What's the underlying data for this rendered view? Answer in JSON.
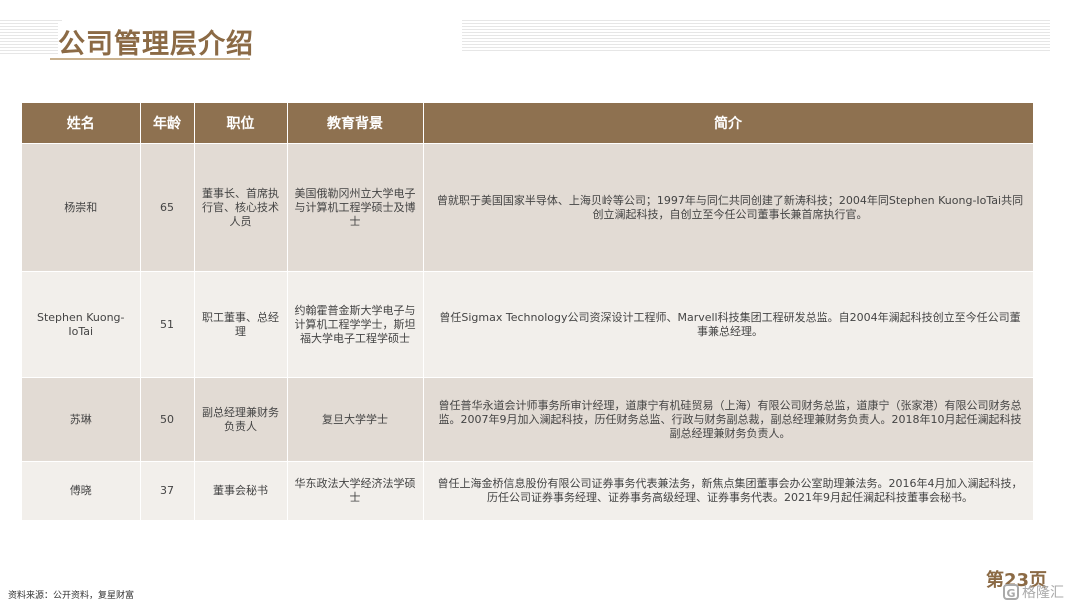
{
  "title": "公司管理层介绍",
  "table": {
    "headers": [
      "姓名",
      "年龄",
      "职位",
      "教育背景",
      "简介"
    ],
    "rows": [
      {
        "name": "杨崇和",
        "age": "65",
        "position": "董事长、首席执行官、核心技术人员",
        "education": "美国俄勒冈州立大学电子与计算机工程学硕士及博士",
        "intro": "曾就职于美国国家半导体、上海贝岭等公司；1997年与同仁共同创建了新涛科技；2004年同Stephen Kuong-IoTai共同创立澜起科技，自创立至今任公司董事长兼首席执行官。"
      },
      {
        "name": "Stephen Kuong-IoTai",
        "age": "51",
        "position": "职工董事、总经理",
        "education": "约翰霍普金斯大学电子与计算机工程学学士，斯坦福大学电子工程学硕士",
        "intro": "曾任Sigmax Technology公司资深设计工程师、Marvell科技集团工程研发总监。自2004年澜起科技创立至今任公司董事兼总经理。"
      },
      {
        "name": "苏琳",
        "age": "50",
        "position": "副总经理兼财务负责人",
        "education": "复旦大学学士",
        "intro": "曾任普华永道会计师事务所审计经理，道康宁有机硅贸易（上海）有限公司财务总监，道康宁（张家港）有限公司财务总监。2007年9月加入澜起科技，历任财务总监、行政与财务副总裁，副总经理兼财务负责人。2018年10月起任澜起科技副总经理兼财务负责人。"
      },
      {
        "name": "傅晓",
        "age": "37",
        "position": "董事会秘书",
        "education": "华东政法大学经济法学硕士",
        "intro": "曾任上海金桥信息股份有限公司证券事务代表兼法务，新焦点集团董事会办公室助理兼法务。2016年4月加入澜起科技，历任公司证券事务经理、证券事务高级经理、证券事务代表。2021年9月起任澜起科技董事会秘书。"
      }
    ]
  },
  "footer": {
    "source": "资料来源：公开资料，复星财富",
    "page": "第23页",
    "logo_text": "格隆汇",
    "logo_icon": "g-logo-icon"
  },
  "colors": {
    "header_bg": "#8e7150",
    "title": "#8b6a45",
    "row_even": "#e2dbd4",
    "row_odd": "#f2efeb"
  }
}
